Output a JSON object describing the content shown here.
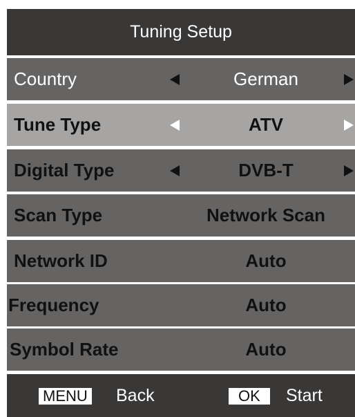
{
  "title": "Tuning Setup",
  "rows": [
    {
      "label": "Country",
      "value": "German"
    },
    {
      "label": "Tune Type",
      "value": "ATV"
    },
    {
      "label": "Digital Type",
      "value": "DVB-T"
    },
    {
      "label": "Scan Type",
      "value": "Network Scan"
    },
    {
      "label": "Network ID",
      "value": "Auto"
    },
    {
      "label": "Frequency",
      "value": "Auto"
    },
    {
      "label": "Symbol Rate",
      "value": "Auto"
    }
  ],
  "footer": {
    "menu_key": "MENU",
    "menu_label": "Back",
    "ok_key": "OK",
    "ok_label": "Start"
  },
  "icons": {
    "left": "left-arrow-icon",
    "right": "right-arrow-icon"
  }
}
